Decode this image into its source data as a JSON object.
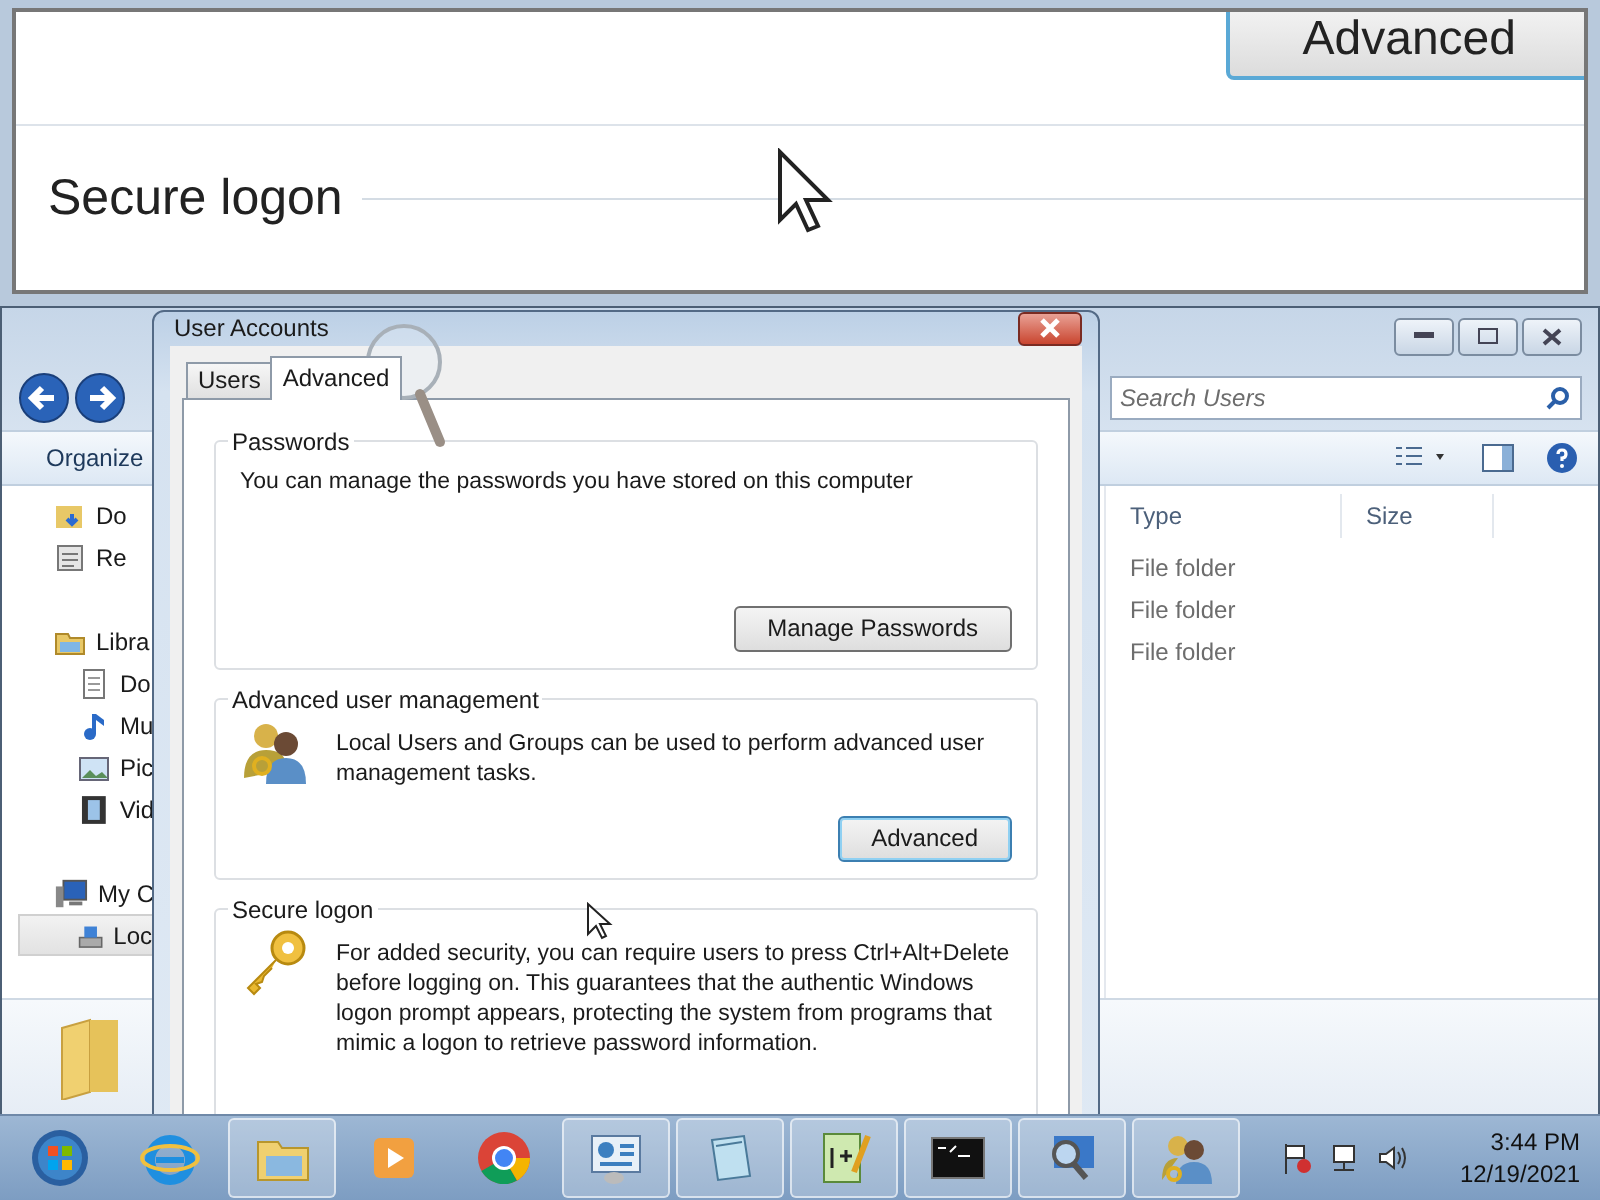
{
  "zoom_inset": {
    "button": "Advanced",
    "group_label": "Secure logon"
  },
  "explorer": {
    "search": {
      "placeholder": "Search Users"
    },
    "toolbar": {
      "organize": "Organize"
    },
    "nav_groups": [
      {
        "label": "Do",
        "selected": false
      },
      {
        "label": "Re",
        "selected": false
      },
      {
        "label": "Libra",
        "selected": false,
        "children": [
          {
            "label": "Do",
            "selected": false
          },
          {
            "label": "Mu",
            "selected": false
          },
          {
            "label": "Pic",
            "selected": false
          },
          {
            "label": "Vid",
            "selected": false
          }
        ]
      },
      {
        "label": "My C",
        "selected": false,
        "children": [
          {
            "label": "Loc",
            "selected": true
          }
        ]
      }
    ],
    "columns": [
      "Type",
      "Size"
    ],
    "rows": [
      {
        "type": "File folder"
      },
      {
        "type": "File folder"
      },
      {
        "type": "File folder"
      }
    ]
  },
  "dialog": {
    "title": "User Accounts",
    "tabs": [
      {
        "label": "Users",
        "selected": false
      },
      {
        "label": "Advanced",
        "selected": true
      }
    ],
    "groups": [
      {
        "kind": "passwords",
        "title": "Passwords",
        "text": "You can manage the passwords you have stored on this computer",
        "button": {
          "label": "Manage Passwords",
          "default": false
        }
      },
      {
        "kind": "user_management",
        "title": "Advanced user management",
        "text": "Local Users and Groups can be used to perform advanced user management tasks.",
        "button": {
          "label": "Advanced",
          "default": true
        }
      },
      {
        "kind": "secure_logon",
        "title": "Secure logon",
        "text": "For added security, you can require users to press Ctrl+Alt+Delete before logging on. This guarantees that the authentic Windows logon prompt appears, protecting the system from programs that mimic a logon to retrieve password information."
      }
    ]
  },
  "taskbar": {
    "time": "3:44 PM",
    "date": "12/19/2021"
  }
}
